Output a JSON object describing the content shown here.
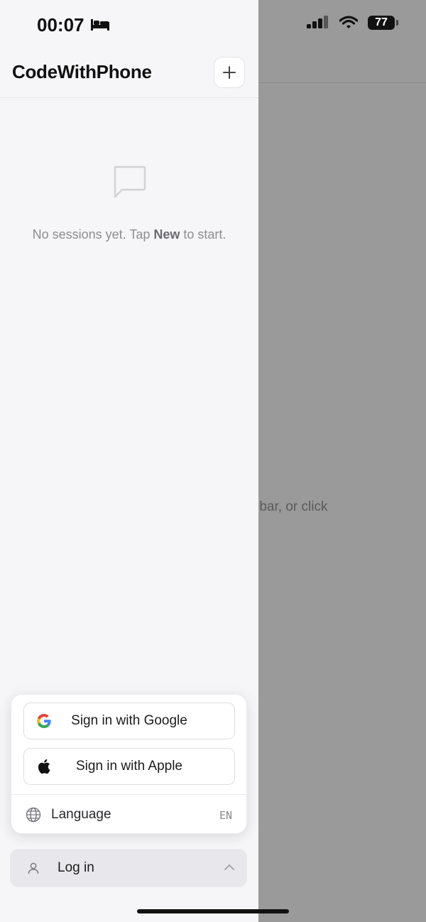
{
  "status_bar": {
    "time": "00:07",
    "battery": "77"
  },
  "sidebar": {
    "app_title": "CodeWithPhone",
    "new_button_glyph": "+",
    "empty_state": {
      "prefix": "No sessions yet. Tap ",
      "emphasis": "New",
      "suffix": " to start."
    }
  },
  "auth_popup": {
    "google_label": "Sign in with Google",
    "apple_label": "Sign in with Apple",
    "language_label": "Language",
    "language_code": "EN"
  },
  "account_bar": {
    "label": "Log in"
  },
  "background": {
    "hint_fragment": "idebar, or click"
  },
  "colors": {
    "sidebar_bg": "#f6f6f8",
    "overlay": "#9a9a9a"
  }
}
